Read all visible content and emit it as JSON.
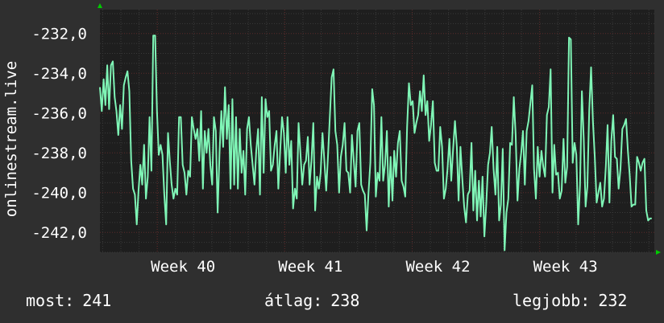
{
  "colors": {
    "background": "#2f2f2f",
    "plot_background": "#1e1e1e",
    "line": "#7ff5b6",
    "grid_minor": "#3a3a3a",
    "grid_major": "#5a2a2a",
    "axis_arrow": "#00cc00",
    "text": "#ffffff"
  },
  "chart_data": {
    "type": "line",
    "ylabel": "onlinestream.live",
    "ylim": [
      -243.0,
      -230.8
    ],
    "y_ticks": [
      {
        "value": -232,
        "label": "-232,0"
      },
      {
        "value": -234,
        "label": "-234,0"
      },
      {
        "value": -236,
        "label": "-236,0"
      },
      {
        "value": -238,
        "label": "-238,0"
      },
      {
        "value": -240,
        "label": "-240,0"
      },
      {
        "value": -242,
        "label": "-242,0"
      }
    ],
    "xlim": [
      0,
      4.35
    ],
    "x_ticks": [
      {
        "value": 0.45,
        "label": "Week 40"
      },
      {
        "value": 1.45,
        "label": "Week 41"
      },
      {
        "value": 2.45,
        "label": "Week 42"
      },
      {
        "value": 3.45,
        "label": "Week 43"
      }
    ],
    "grid": true,
    "series": [
      {
        "values": [
          -234.7,
          -235.9,
          -234.3,
          -235.6,
          -233.6,
          -235.8,
          -233.6,
          -233.4,
          -235.2,
          -235.9,
          -237.1,
          -235.6,
          -236.8,
          -234.6,
          -234.2,
          -233.9,
          -234.9,
          -238.4,
          -239.8,
          -240.1,
          -241.6,
          -239.9,
          -238.6,
          -239.6,
          -237.6,
          -240.3,
          -239.2,
          -236.2,
          -238.9,
          -232.1,
          -232.1,
          -235.9,
          -238.1,
          -237.6,
          -238.1,
          -240.1,
          -241.6,
          -237.0,
          -238.4,
          -239.6,
          -240.3,
          -239.8,
          -240.1,
          -236.2,
          -236.2,
          -238.6,
          -239.0,
          -240.1,
          -238.9,
          -239.2,
          -236.2,
          -236.8,
          -237.3,
          -236.8,
          -238.4,
          -235.9,
          -239.8,
          -236.9,
          -238.0,
          -236.8,
          -238.6,
          -239.6,
          -236.2,
          -236.9,
          -241.0,
          -238.0,
          -235.9,
          -237.7,
          -234.7,
          -237.3,
          -235.6,
          -239.8,
          -235.3,
          -239.6,
          -236.2,
          -239.8,
          -236.8,
          -239.0,
          -237.9,
          -240.1,
          -236.8,
          -236.2,
          -237.6,
          -238.6,
          -239.6,
          -237.9,
          -236.8,
          -240.1,
          -235.2,
          -239.0,
          -235.3,
          -236.2,
          -235.9,
          -238.9,
          -238.6,
          -237.6,
          -236.9,
          -239.8,
          -237.9,
          -236.2,
          -237.0,
          -239.0,
          -236.2,
          -238.6,
          -237.4,
          -240.8,
          -239.8,
          -240.3,
          -236.5,
          -238.0,
          -239.6,
          -238.6,
          -238.4,
          -237.2,
          -239.6,
          -238.4,
          -236.5,
          -240.9,
          -239.2,
          -239.8,
          -239.0,
          -237.0,
          -238.4,
          -239.9,
          -238.1,
          -236.2,
          -234.2,
          -233.8,
          -236.9,
          -237.6,
          -240.0,
          -238.2,
          -237.6,
          -236.5,
          -238.9,
          -239.0,
          -240.0,
          -237.1,
          -238.4,
          -239.7,
          -236.9,
          -236.5,
          -239.6,
          -239.9,
          -240.1,
          -241.9,
          -240.0,
          -238.5,
          -234.8,
          -235.6,
          -240.2,
          -239.0,
          -239.4,
          -236.2,
          -239.4,
          -238.6,
          -236.9,
          -240.7,
          -238.2,
          -240.4,
          -237.9,
          -239.2,
          -237.5,
          -236.9,
          -239.4,
          -239.7,
          -240.2,
          -236.7,
          -234.5,
          -235.6,
          -235.4,
          -237.0,
          -236.5,
          -236.1,
          -234.9,
          -235.9,
          -234.1,
          -236.1,
          -235.4,
          -237.4,
          -236.6,
          -235.4,
          -238.5,
          -238.9,
          -238.9,
          -236.7,
          -237.7,
          -240.3,
          -239.8,
          -238.8,
          -237.3,
          -239.4,
          -237.8,
          -236.4,
          -237.7,
          -240.4,
          -237.7,
          -239.3,
          -240.7,
          -241.5,
          -240.1,
          -239.9,
          -237.5,
          -240.9,
          -238.9,
          -241.4,
          -239.4,
          -241.2,
          -239.2,
          -242.2,
          -240.6,
          -238.6,
          -238.0,
          -236.7,
          -238.8,
          -240.1,
          -237.7,
          -241.4,
          -240.6,
          -237.8,
          -242.9,
          -241.0,
          -240.3,
          -237.5,
          -237.6,
          -235.2,
          -237.1,
          -240.4,
          -238.8,
          -238.0,
          -236.9,
          -239.6,
          -236.9,
          -236.4,
          -235.5,
          -234.6,
          -238.8,
          -240.3,
          -237.7,
          -239.2,
          -237.9,
          -238.7,
          -239.2,
          -236.1,
          -235.7,
          -233.8,
          -240.0,
          -237.6,
          -239.1,
          -239.0,
          -240.3,
          -239.9,
          -237.3,
          -239.5,
          -238.7,
          -232.2,
          -232.3,
          -238.5,
          -237.5,
          -238.1,
          -241.6,
          -239.6,
          -234.9,
          -237.3,
          -240.7,
          -239.7,
          -235.9,
          -233.7,
          -236.4,
          -238.2,
          -240.5,
          -240.0,
          -239.5,
          -240.7,
          -240.3,
          -238.7,
          -236.6,
          -240.5,
          -237.4,
          -236.1,
          -238.2,
          -238.3,
          -239.8,
          -238.8,
          -236.8,
          -236.6,
          -236.3,
          -237.9,
          -239.1,
          -240.7,
          -240.6,
          -240.6,
          -238.2,
          -238.5,
          -238.9,
          -238.5,
          -238.3,
          -240.9,
          -241.4,
          -241.3,
          -241.3
        ]
      }
    ]
  },
  "footer": {
    "current_label": "most:",
    "current_value": "241",
    "average_label": "átlag:",
    "average_value": "238",
    "best_label": "legjobb:",
    "best_value": "232"
  }
}
